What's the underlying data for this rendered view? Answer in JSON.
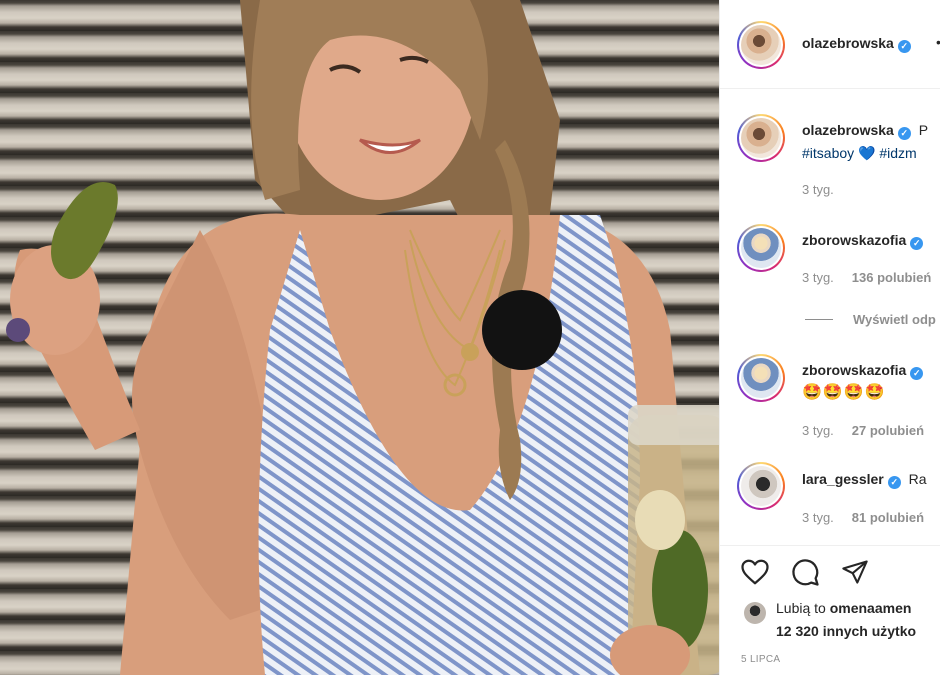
{
  "post": {
    "author": "olazebrowska",
    "header_more": "•",
    "caption_start": "P",
    "caption_tags": "#itsaboy",
    "caption_heart": "💙",
    "caption_tag2": "#idzm",
    "caption_time": "3 tyg.",
    "verified_mark": "✓"
  },
  "comments": [
    {
      "username": "zborowskazofia",
      "text": "",
      "time": "3 tyg.",
      "likes": "136 polubień",
      "replies": "Wyświetl odp"
    },
    {
      "username": "zborowskazofia",
      "text": "🤩🤩🤩🤩",
      "time": "3 tyg.",
      "likes": "27 polubień"
    },
    {
      "username": "lara_gessler",
      "text": "Ra",
      "time": "3 tyg.",
      "likes": "81 polubień"
    }
  ],
  "actions": {
    "like_icon": "heart-icon",
    "comment_icon": "comment-icon",
    "share_icon": "share-icon"
  },
  "likes": {
    "prefix": "Lubią to ",
    "user": "omenaamen",
    "others": "12 320 innych użytko"
  },
  "date": "5 LIPCA",
  "colors": {
    "link": "#00376b",
    "verified": "#3897f0",
    "muted": "#8e8e8e"
  }
}
